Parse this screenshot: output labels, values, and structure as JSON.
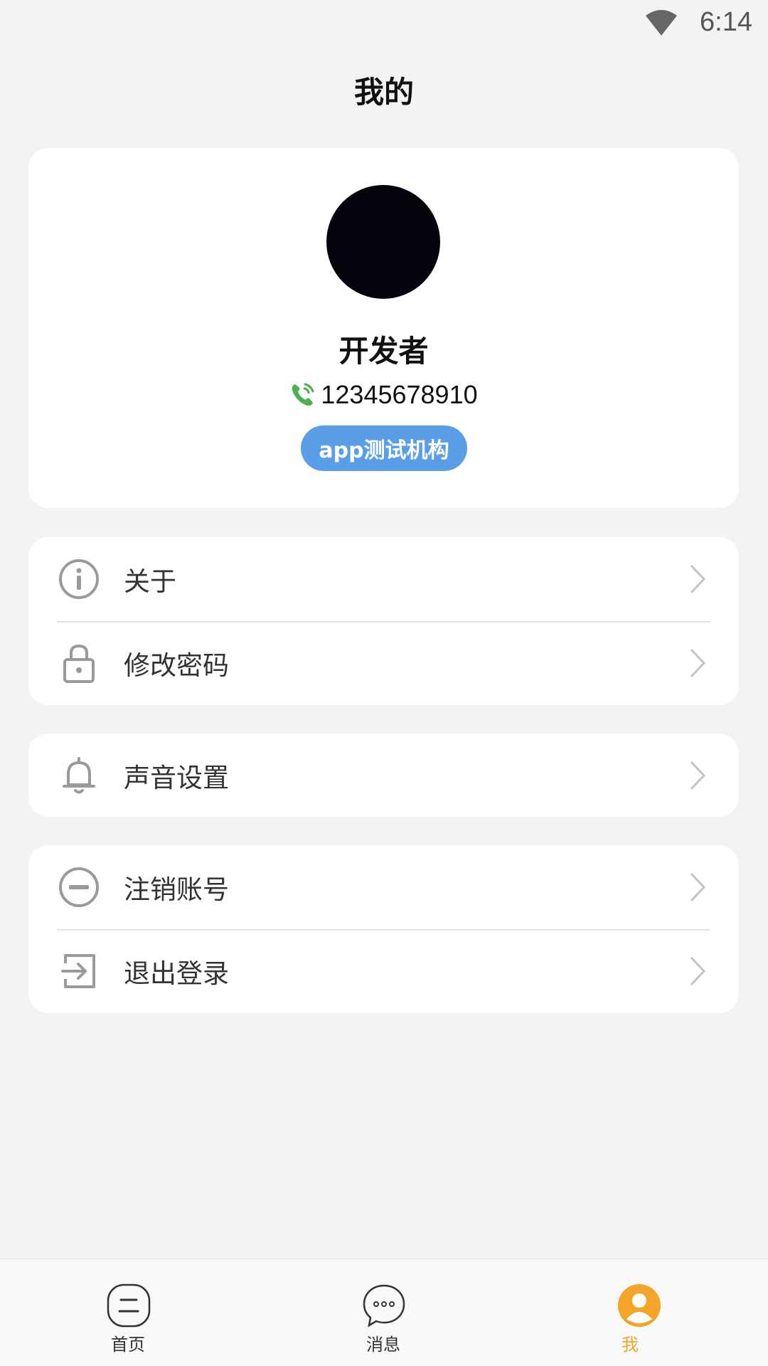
{
  "status_bar": {
    "time": "6:14"
  },
  "page": {
    "title": "我的"
  },
  "profile": {
    "name": "开发者",
    "phone": "12345678910",
    "organization": "app测试机构"
  },
  "menu_groups": [
    {
      "items": [
        {
          "label": "关于",
          "icon": "info-icon"
        },
        {
          "label": "修改密码",
          "icon": "lock-icon"
        }
      ]
    },
    {
      "items": [
        {
          "label": "声音设置",
          "icon": "bell-icon"
        }
      ]
    },
    {
      "items": [
        {
          "label": "注销账号",
          "icon": "minus-circle-icon"
        },
        {
          "label": "退出登录",
          "icon": "logout-icon"
        }
      ]
    }
  ],
  "bottom_nav": {
    "items": [
      {
        "label": "首页",
        "icon": "home-icon",
        "active": false
      },
      {
        "label": "消息",
        "icon": "message-icon",
        "active": false
      },
      {
        "label": "我",
        "icon": "profile-icon",
        "active": true
      }
    ]
  },
  "colors": {
    "background": "#f2f3f5",
    "card": "#ffffff",
    "badge": "#5b9ee8",
    "phone_icon": "#4caf50",
    "active_tab": "#f4a428",
    "icon_gray": "#9a9a9a"
  }
}
